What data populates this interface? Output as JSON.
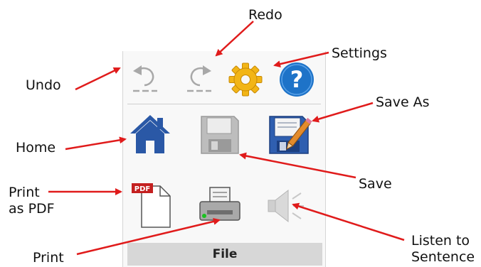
{
  "toolbar": {
    "group_label": "File",
    "tools": [
      {
        "id": "undo",
        "icon": "undo-icon"
      },
      {
        "id": "redo",
        "icon": "redo-icon"
      },
      {
        "id": "settings",
        "icon": "gear-icon"
      },
      {
        "id": "help",
        "icon": "help-icon"
      },
      {
        "id": "home",
        "icon": "home-icon"
      },
      {
        "id": "save",
        "icon": "floppy-disk-icon"
      },
      {
        "id": "save-as",
        "icon": "floppy-pencil-icon"
      },
      {
        "id": "print-pdf",
        "icon": "pdf-document-icon",
        "badge": "PDF"
      },
      {
        "id": "print",
        "icon": "printer-icon"
      },
      {
        "id": "listen",
        "icon": "speaker-icon"
      }
    ]
  },
  "callouts": {
    "redo": "Redo",
    "settings": "Settings",
    "undo": "Undo",
    "save_as": "Save As",
    "home": "Home",
    "save": "Save",
    "print_pdf_line1": "Print",
    "print_pdf_line2": "as PDF",
    "print": "Print",
    "listen_line1": "Listen to",
    "listen_line2": "Sentence"
  },
  "colors": {
    "arrow": "#e01b1b",
    "home": "#2a58a6",
    "gear": "#f2b516",
    "help": "#1e73c8",
    "disabled": "#a8a8a8",
    "pdf_badge": "#c42020"
  }
}
